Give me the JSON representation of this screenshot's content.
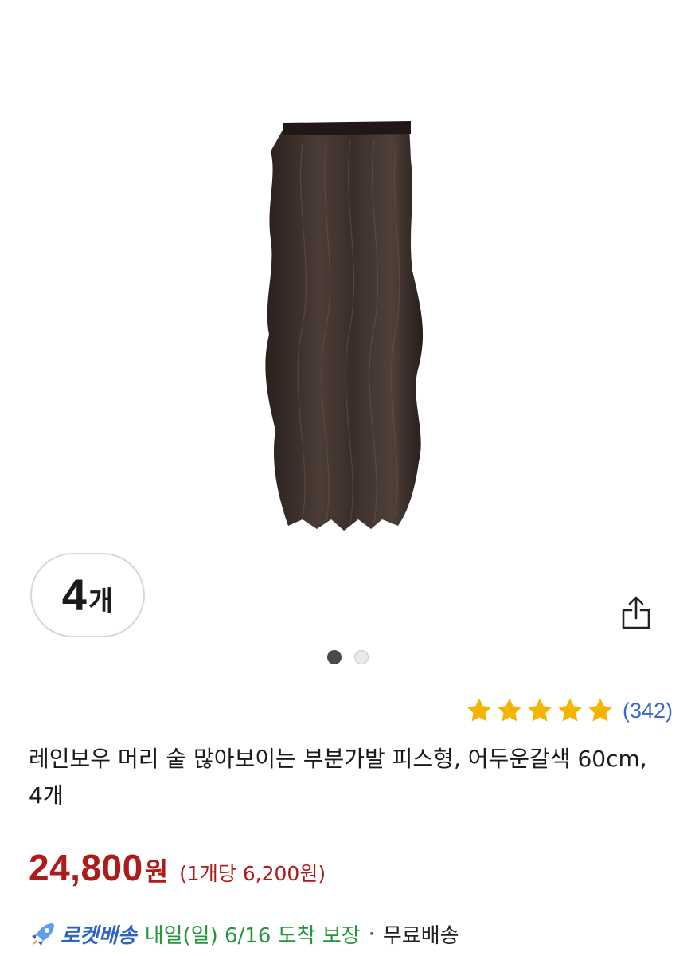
{
  "product_image": {
    "icon": "hair-extension-image",
    "dots": [
      true,
      false
    ]
  },
  "quantity_badge": {
    "number": "4",
    "unit": "개"
  },
  "share": {
    "icon": "share-icon"
  },
  "rating": {
    "stars": 5,
    "max_stars": 5,
    "count_text": "(342)",
    "star_color": "#F5B400"
  },
  "product": {
    "title": "레인보우 머리 숱 많아보이는 부분가발 피스형, 어두운갈색 60cm, 4개"
  },
  "price": {
    "amount": "24,800",
    "currency": "원",
    "unit_price": "(1개당 6,200원)",
    "color": "#AE1B1B"
  },
  "delivery": {
    "rocket_label": "로켓배송",
    "arrival": "내일(일) 6/16 도착 보장",
    "separator": "·",
    "shipping": "무료배송",
    "rocket_color": "#2F63C6",
    "arrival_color": "#23963B"
  }
}
